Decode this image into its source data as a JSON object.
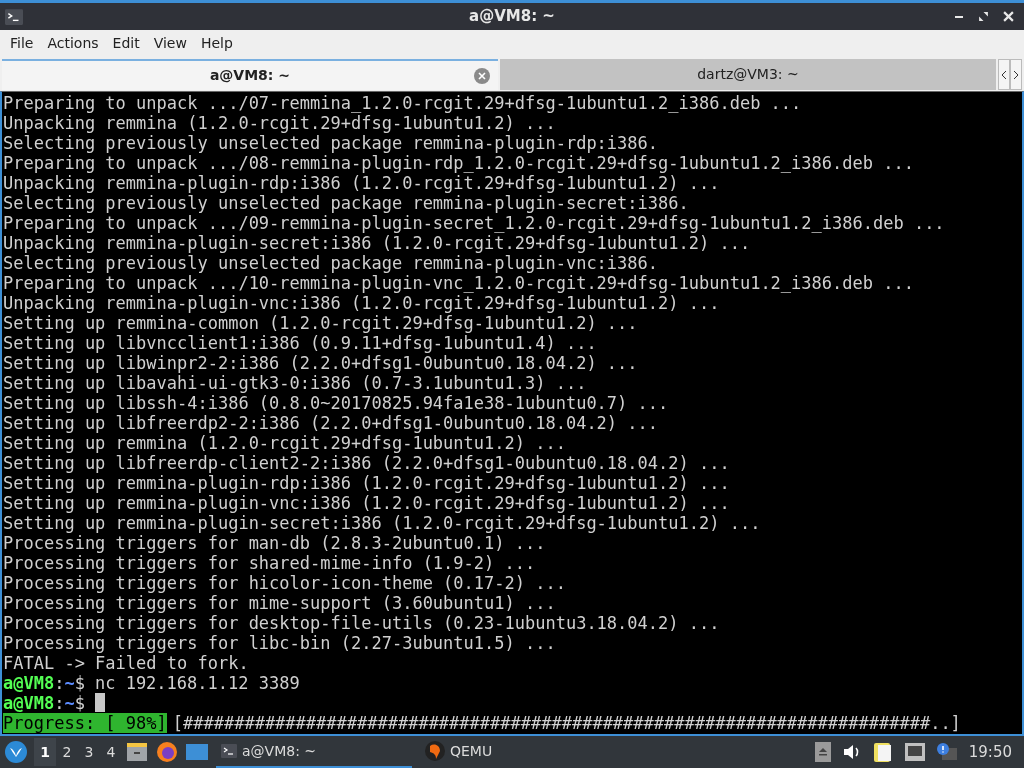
{
  "window": {
    "title": "a@VM8: ~"
  },
  "menu": [
    "File",
    "Actions",
    "Edit",
    "View",
    "Help"
  ],
  "tabs": [
    {
      "label": "a@VM8: ~",
      "selected": true
    },
    {
      "label": "dartz@VM3: ~",
      "selected": false
    }
  ],
  "terminal": {
    "lines": [
      {
        "kind": "output",
        "text": "Preparing to unpack .../07-remmina_1.2.0-rcgit.29+dfsg-1ubuntu1.2_i386.deb ..."
      },
      {
        "kind": "output",
        "text": "Unpacking remmina (1.2.0-rcgit.29+dfsg-1ubuntu1.2) ..."
      },
      {
        "kind": "output",
        "text": "Selecting previously unselected package remmina-plugin-rdp:i386."
      },
      {
        "kind": "output",
        "text": "Preparing to unpack .../08-remmina-plugin-rdp_1.2.0-rcgit.29+dfsg-1ubuntu1.2_i386.deb ..."
      },
      {
        "kind": "output",
        "text": "Unpacking remmina-plugin-rdp:i386 (1.2.0-rcgit.29+dfsg-1ubuntu1.2) ..."
      },
      {
        "kind": "output",
        "text": "Selecting previously unselected package remmina-plugin-secret:i386."
      },
      {
        "kind": "output",
        "text": "Preparing to unpack .../09-remmina-plugin-secret_1.2.0-rcgit.29+dfsg-1ubuntu1.2_i386.deb ..."
      },
      {
        "kind": "output",
        "text": "Unpacking remmina-plugin-secret:i386 (1.2.0-rcgit.29+dfsg-1ubuntu1.2) ..."
      },
      {
        "kind": "output",
        "text": "Selecting previously unselected package remmina-plugin-vnc:i386."
      },
      {
        "kind": "output",
        "text": "Preparing to unpack .../10-remmina-plugin-vnc_1.2.0-rcgit.29+dfsg-1ubuntu1.2_i386.deb ..."
      },
      {
        "kind": "output",
        "text": "Unpacking remmina-plugin-vnc:i386 (1.2.0-rcgit.29+dfsg-1ubuntu1.2) ..."
      },
      {
        "kind": "output",
        "text": "Setting up remmina-common (1.2.0-rcgit.29+dfsg-1ubuntu1.2) ..."
      },
      {
        "kind": "output",
        "text": "Setting up libvncclient1:i386 (0.9.11+dfsg-1ubuntu1.4) ..."
      },
      {
        "kind": "output",
        "text": "Setting up libwinpr2-2:i386 (2.2.0+dfsg1-0ubuntu0.18.04.2) ..."
      },
      {
        "kind": "output",
        "text": "Setting up libavahi-ui-gtk3-0:i386 (0.7-3.1ubuntu1.3) ..."
      },
      {
        "kind": "output",
        "text": "Setting up libssh-4:i386 (0.8.0~20170825.94fa1e38-1ubuntu0.7) ..."
      },
      {
        "kind": "output",
        "text": "Setting up libfreerdp2-2:i386 (2.2.0+dfsg1-0ubuntu0.18.04.2) ..."
      },
      {
        "kind": "output",
        "text": "Setting up remmina (1.2.0-rcgit.29+dfsg-1ubuntu1.2) ..."
      },
      {
        "kind": "output",
        "text": "Setting up libfreerdp-client2-2:i386 (2.2.0+dfsg1-0ubuntu0.18.04.2) ..."
      },
      {
        "kind": "output",
        "text": "Setting up remmina-plugin-rdp:i386 (1.2.0-rcgit.29+dfsg-1ubuntu1.2) ..."
      },
      {
        "kind": "output",
        "text": "Setting up remmina-plugin-vnc:i386 (1.2.0-rcgit.29+dfsg-1ubuntu1.2) ..."
      },
      {
        "kind": "output",
        "text": "Setting up remmina-plugin-secret:i386 (1.2.0-rcgit.29+dfsg-1ubuntu1.2) ..."
      },
      {
        "kind": "output",
        "text": "Processing triggers for man-db (2.8.3-2ubuntu0.1) ..."
      },
      {
        "kind": "output",
        "text": "Processing triggers for shared-mime-info (1.9-2) ..."
      },
      {
        "kind": "output",
        "text": "Processing triggers for hicolor-icon-theme (0.17-2) ..."
      },
      {
        "kind": "output",
        "text": "Processing triggers for mime-support (3.60ubuntu1) ..."
      },
      {
        "kind": "output",
        "text": "Processing triggers for desktop-file-utils (0.23-1ubuntu3.18.04.2) ..."
      },
      {
        "kind": "output",
        "text": "Processing triggers for libc-bin (2.27-3ubuntu1.5) ..."
      },
      {
        "kind": "output",
        "text": "FATAL -> Failed to fork."
      },
      {
        "kind": "prompt",
        "user_host": "a@VM8",
        "separator": ":",
        "path": "~",
        "symbol": "$",
        "command": "nc 192.168.1.12 3389",
        "cursor": false
      },
      {
        "kind": "prompt",
        "user_host": "a@VM8",
        "separator": ":",
        "path": "~",
        "symbol": "$",
        "cursor": true
      },
      {
        "kind": "progress",
        "label": "Progress: [ 98%]",
        "bar": "[#########################################################################..]"
      }
    ]
  },
  "taskbar": {
    "desktops": [
      {
        "label": "1",
        "selected": true
      },
      {
        "label": "2",
        "selected": false
      },
      {
        "label": "3",
        "selected": false
      },
      {
        "label": "4",
        "selected": false
      }
    ],
    "tasks": [
      {
        "label": "a@VM8: ~",
        "kind": "terminal",
        "selected": true
      },
      {
        "label": "QEMU",
        "kind": "qemu",
        "selected": false
      }
    ],
    "clock": "19:50"
  }
}
